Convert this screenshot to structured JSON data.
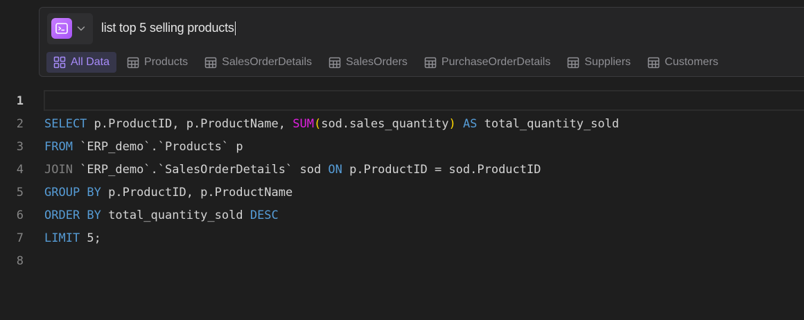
{
  "prompt": {
    "text": "list top 5 selling products"
  },
  "tabs": [
    {
      "label": "All Data",
      "icon": "grid-icon",
      "active": true
    },
    {
      "label": "Products",
      "icon": "table-icon"
    },
    {
      "label": "SalesOrderDetails",
      "icon": "table-icon"
    },
    {
      "label": "SalesOrders",
      "icon": "table-icon"
    },
    {
      "label": "PurchaseOrderDetails",
      "icon": "table-icon"
    },
    {
      "label": "Suppliers",
      "icon": "table-icon"
    },
    {
      "label": "Customers",
      "icon": "table-icon"
    }
  ],
  "editor": {
    "line_numbers": [
      "1",
      "2",
      "3",
      "4",
      "5",
      "6",
      "7",
      "8"
    ],
    "lines": [
      [],
      [
        {
          "t": "SELECT",
          "c": "kw"
        },
        {
          "t": " p.ProductID, p.ProductName, ",
          "c": ""
        },
        {
          "t": "SUM",
          "c": "fn"
        },
        {
          "t": "(",
          "c": "paren"
        },
        {
          "t": "sod.sales_quantity",
          "c": ""
        },
        {
          "t": ")",
          "c": "paren"
        },
        {
          "t": " ",
          "c": ""
        },
        {
          "t": "AS",
          "c": "kw"
        },
        {
          "t": " total_quantity_sold",
          "c": ""
        }
      ],
      [
        {
          "t": "FROM",
          "c": "kw"
        },
        {
          "t": " `ERP_demo`.`Products` p",
          "c": ""
        }
      ],
      [
        {
          "t": "JOIN",
          "c": "kw-gray"
        },
        {
          "t": " `ERP_demo`.`SalesOrderDetails` sod ",
          "c": ""
        },
        {
          "t": "ON",
          "c": "kw"
        },
        {
          "t": " p.ProductID = sod.ProductID",
          "c": ""
        }
      ],
      [
        {
          "t": "GROUP BY",
          "c": "kw"
        },
        {
          "t": " p.ProductID, p.ProductName",
          "c": ""
        }
      ],
      [
        {
          "t": "ORDER BY",
          "c": "kw"
        },
        {
          "t": " total_quantity_sold ",
          "c": ""
        },
        {
          "t": "DESC",
          "c": "kw"
        }
      ],
      [
        {
          "t": "LIMIT",
          "c": "kw"
        },
        {
          "t": " 5;",
          "c": ""
        }
      ],
      []
    ]
  },
  "colors": {
    "accent": "#a78bfa",
    "keyword": "#569cd6",
    "function": "#e020e0",
    "bracket": "#ffd700",
    "background": "#1e1e1e"
  }
}
